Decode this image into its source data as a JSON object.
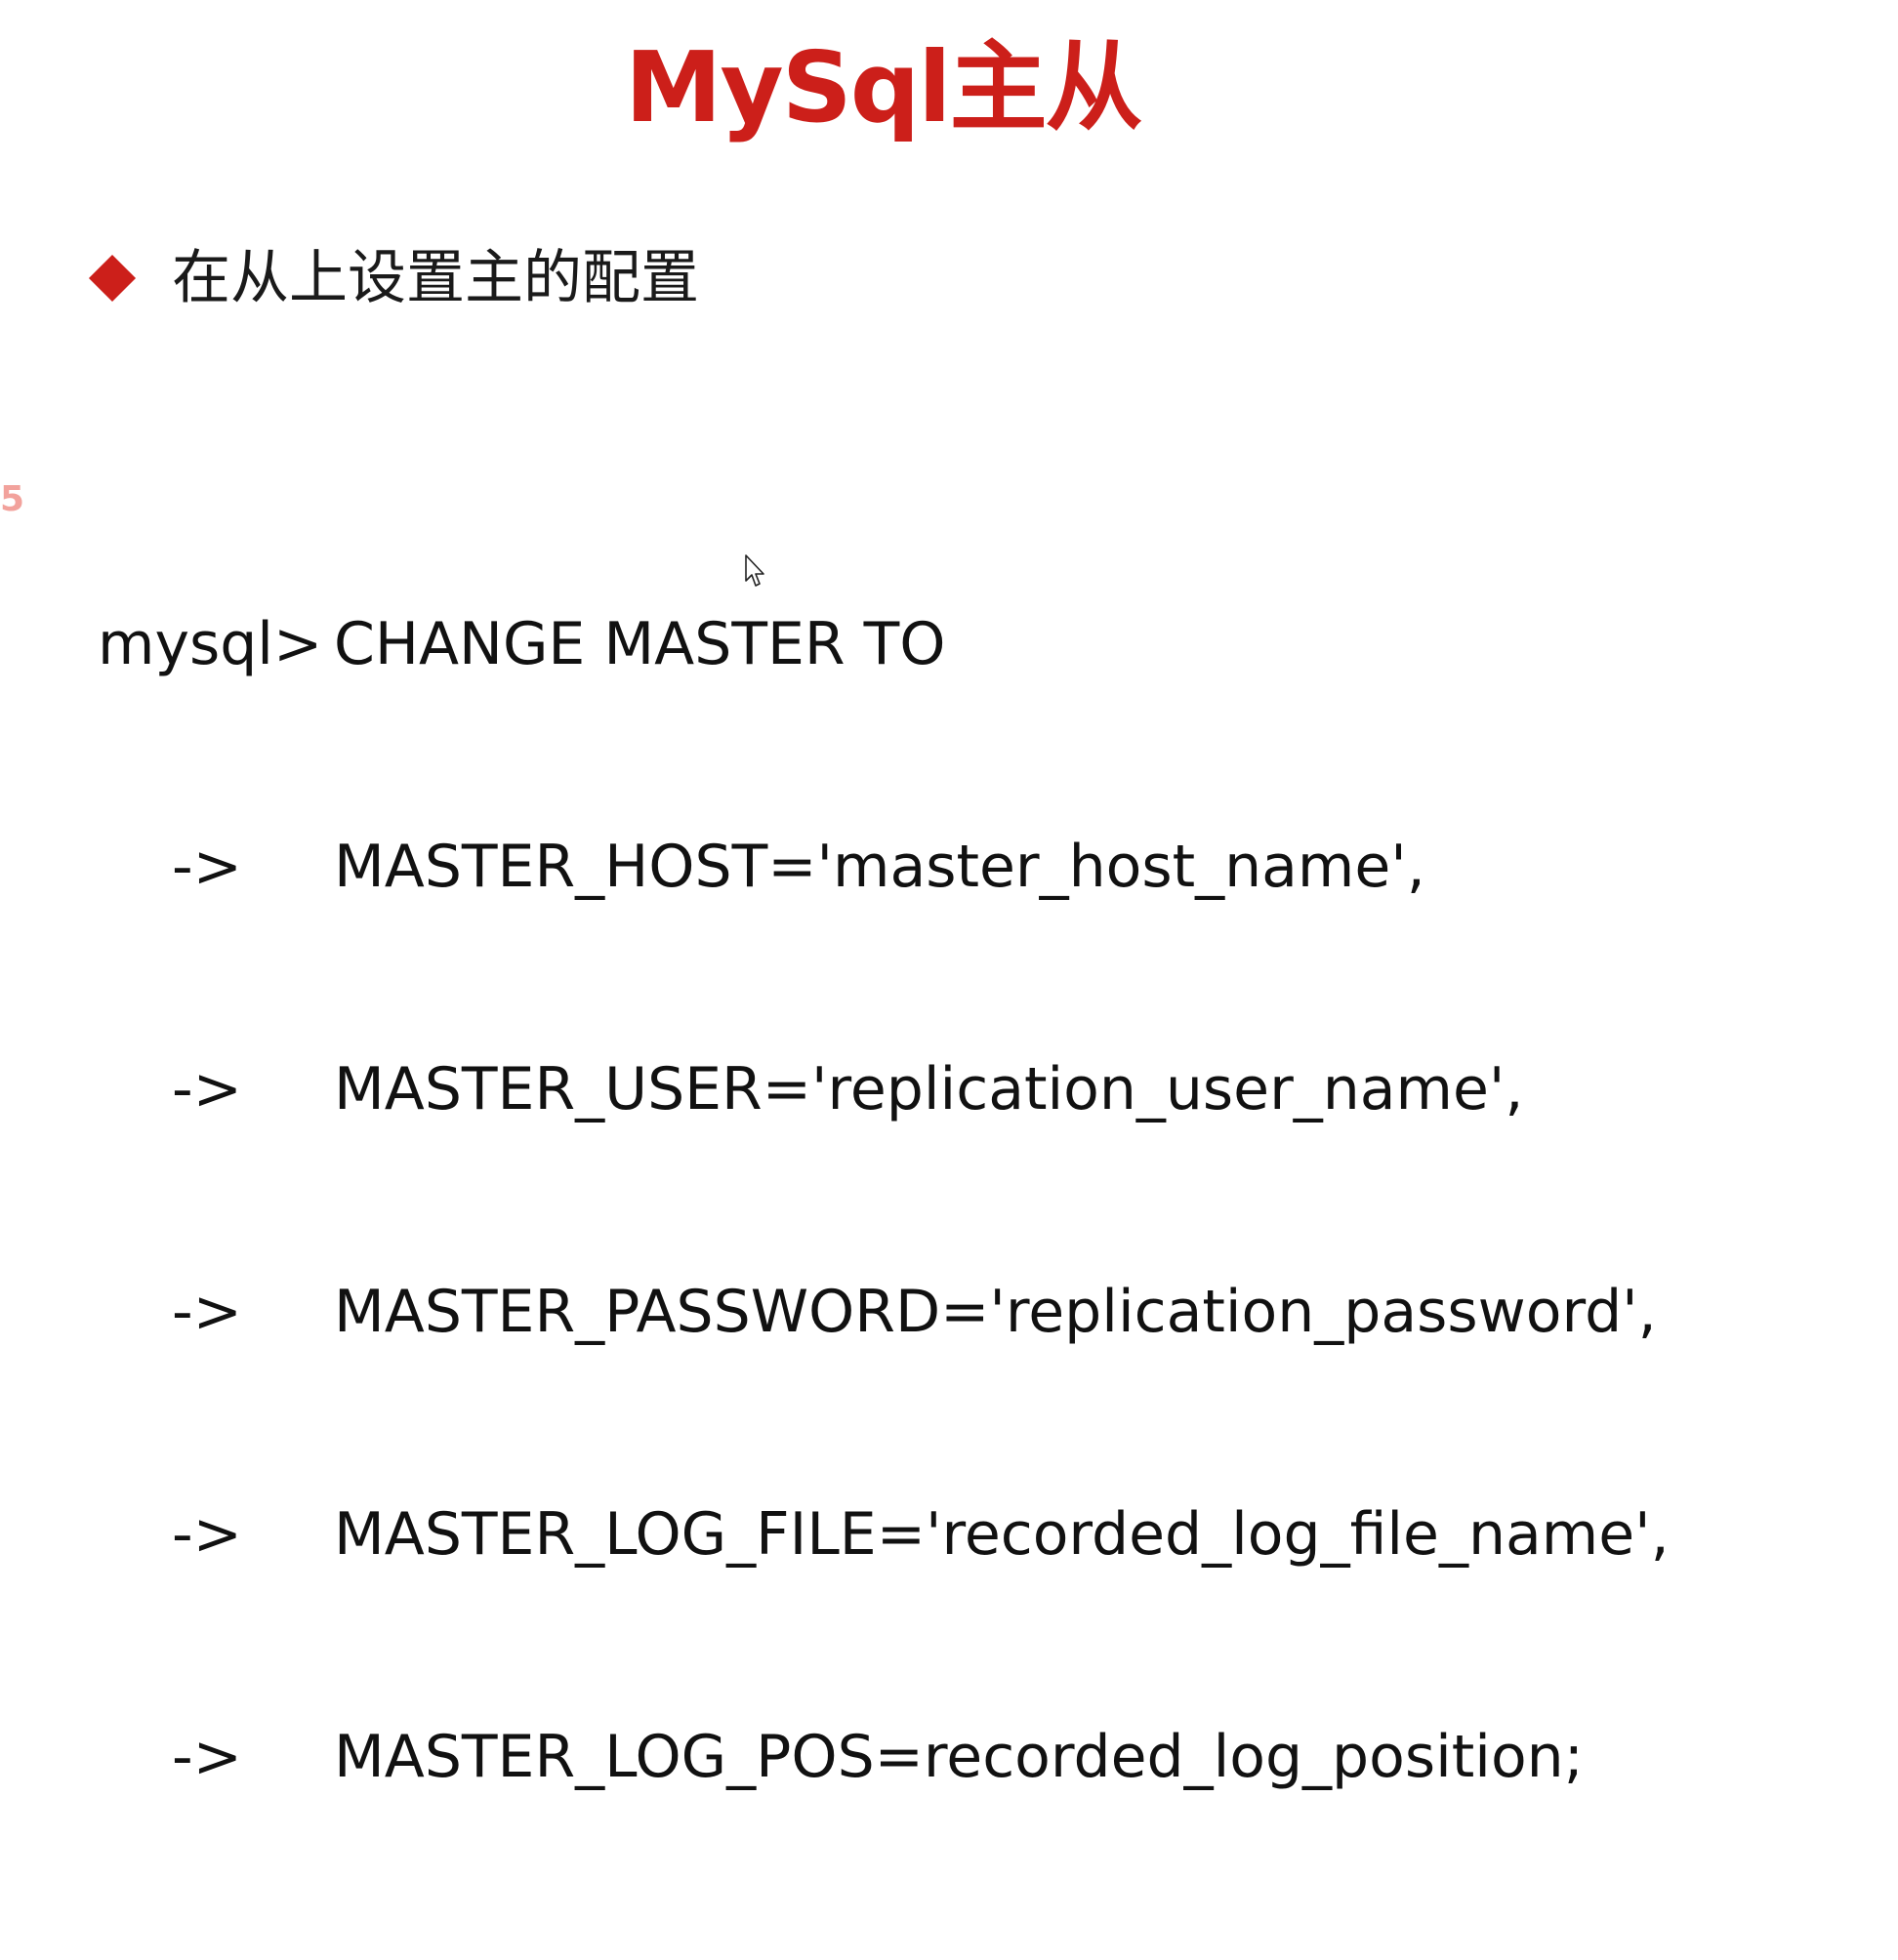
{
  "title": "MySql主从",
  "bullet": {
    "text": "在从上设置主的配置"
  },
  "side_number": "5",
  "code": {
    "prompt": "mysql>",
    "continuation": "->",
    "lines": [
      "CHANGE MASTER TO",
      "MASTER_HOST='master_host_name',",
      "MASTER_USER='replication_user_name',",
      "MASTER_PASSWORD='replication_password',",
      "MASTER_LOG_FILE='recorded_log_file_name',",
      "MASTER_LOG_POS=recorded_log_position;"
    ]
  },
  "colors": {
    "accent": "#cc1f1a",
    "side_number": "#f2a29c",
    "text": "#111111"
  },
  "icons": {
    "bullet": "diamond-bullet-icon",
    "cursor": "mouse-pointer-icon"
  }
}
